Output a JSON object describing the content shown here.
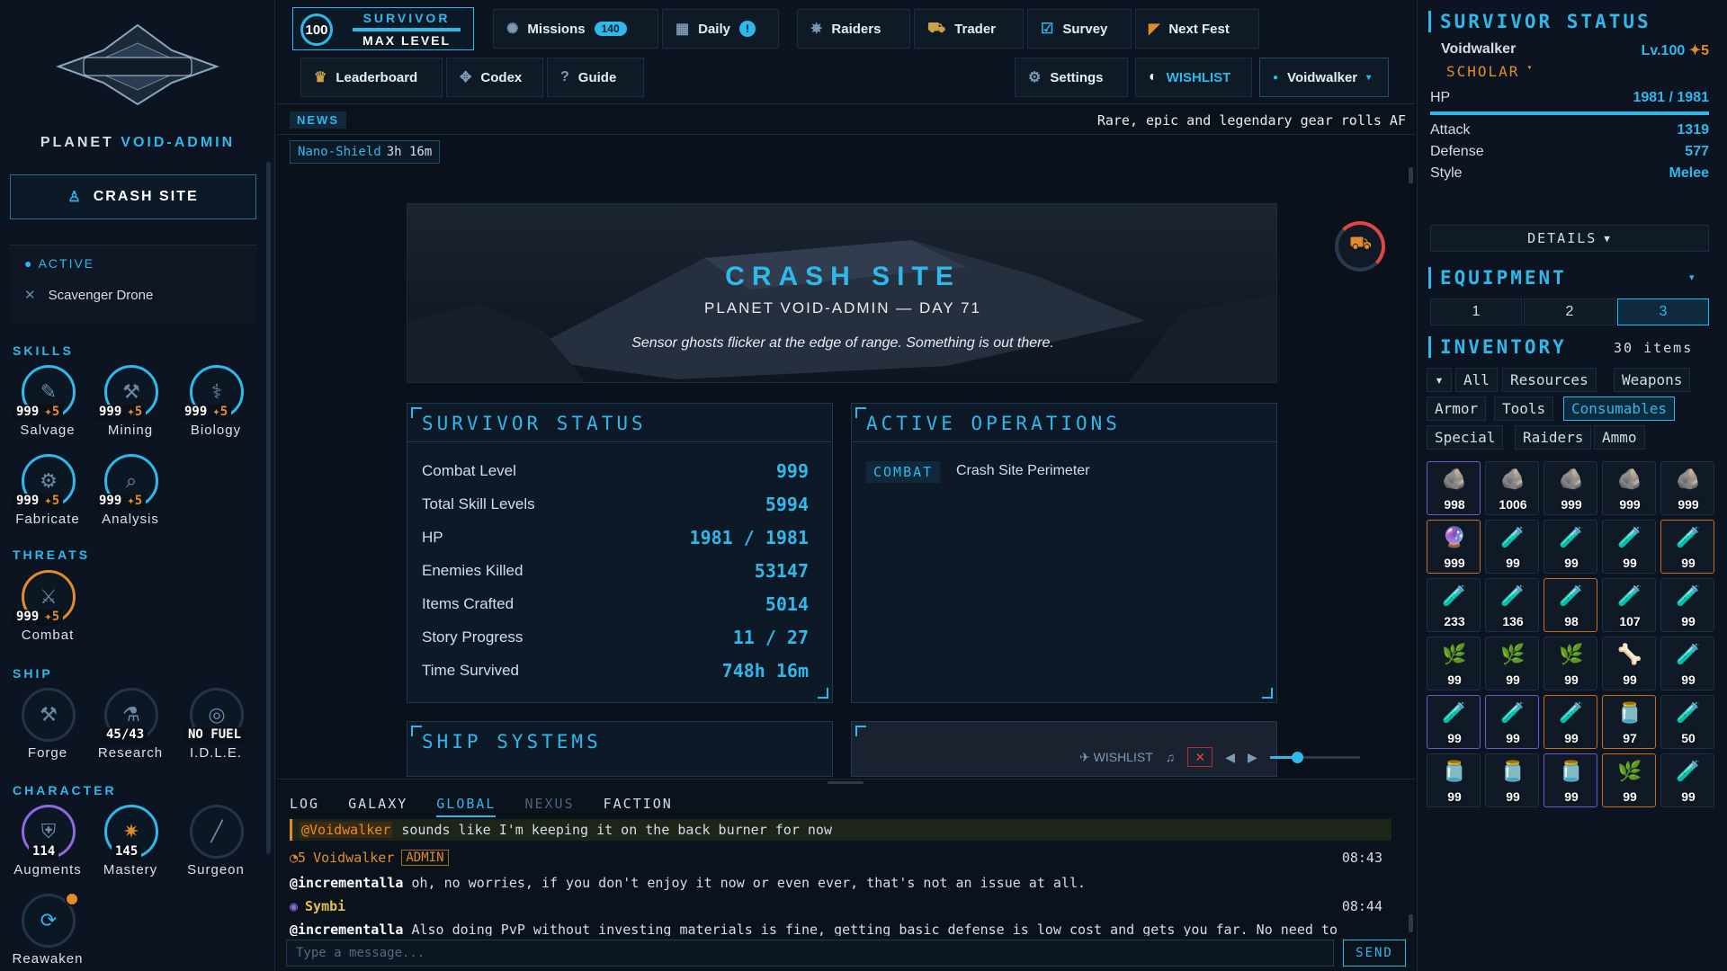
{
  "left": {
    "planet_prefix": "PLANET",
    "planet_name": "VOID-ADMIN",
    "crash_site_label": "CRASH SITE",
    "active_label": "ACTIVE",
    "active_item": "Scavenger Drone",
    "skills_title": "SKILLS",
    "skills": [
      {
        "name": "Salvage",
        "level": "999",
        "bonus": "5",
        "icon": "wrench-icon"
      },
      {
        "name": "Mining",
        "level": "999",
        "bonus": "5",
        "icon": "pickaxe-icon"
      },
      {
        "name": "Biology",
        "level": "999",
        "bonus": "5",
        "icon": "syringe-icon"
      },
      {
        "name": "Fabricate",
        "level": "999",
        "bonus": "5",
        "icon": "anvil-icon"
      },
      {
        "name": "Analysis",
        "level": "999",
        "bonus": "5",
        "icon": "magnifier-icon"
      }
    ],
    "threats_title": "THREATS",
    "threats": [
      {
        "name": "Combat",
        "level": "999",
        "bonus": "5",
        "icon": "crossed-swords-icon"
      }
    ],
    "ship_title": "SHIP",
    "ship": [
      {
        "name": "Forge",
        "value": "",
        "icon": "forge-icon"
      },
      {
        "name": "Research",
        "value": "45/43",
        "icon": "flask-icon"
      },
      {
        "name": "I.D.L.E.",
        "value": "NO FUEL",
        "icon": "ai-core-icon"
      }
    ],
    "character_title": "CHARACTER",
    "character": [
      {
        "name": "Augments",
        "value": "114",
        "icon": "shield-augment-icon"
      },
      {
        "name": "Mastery",
        "value": "145",
        "icon": "mastery-star-icon"
      },
      {
        "name": "Surgeon",
        "value": "",
        "icon": "scalpel-icon"
      },
      {
        "name": "Reawaken",
        "value": "",
        "icon": "reawaken-icon"
      }
    ]
  },
  "top": {
    "level": "100",
    "level_title": "SURVIVOR",
    "level_status": "MAX LEVEL",
    "missions_label": "Missions",
    "missions_count": "140",
    "daily_label": "Daily",
    "daily_badge": "!",
    "raiders_label": "Raiders",
    "trader_label": "Trader",
    "survey_label": "Survey",
    "next_fest_label": "Next Fest",
    "leaderboard_label": "Leaderboard",
    "codex_label": "Codex",
    "guide_label": "Guide",
    "settings_label": "Settings",
    "wishlist_label": "WISHLIST",
    "user_label": "Voidwalker"
  },
  "news": {
    "tag": "NEWS",
    "text": "Rare, epic and legendary gear rolls AF",
    "buff_name": "Nano-Shield",
    "buff_time": "3h 16m"
  },
  "hero": {
    "title": "CRASH SITE",
    "subtitle": "PLANET VOID-ADMIN — DAY 71",
    "description": "Sensor ghosts flicker at the edge of range. Something is out there."
  },
  "survivor_panel": {
    "title": "SURVIVOR STATUS",
    "rows": [
      {
        "label": "Combat Level",
        "value": "999"
      },
      {
        "label": "Total Skill Levels",
        "value": "5994"
      },
      {
        "label": "HP",
        "value": "1981 / 1981"
      },
      {
        "label": "Enemies Killed",
        "value": "53147"
      },
      {
        "label": "Items Crafted",
        "value": "5014"
      },
      {
        "label": "Story Progress",
        "value": "11 / 27"
      },
      {
        "label": "Time Survived",
        "value": "748h 16m"
      }
    ]
  },
  "operations_panel": {
    "title": "ACTIVE OPERATIONS",
    "tag": "COMBAT",
    "operation": "Crash Site Perimeter"
  },
  "ship_systems_title": "SHIP SYSTEMS",
  "music": {
    "wishlist": "WISHLIST",
    "close": "✕",
    "volume": 0.3
  },
  "chat": {
    "tabs": [
      "LOG",
      "GALAXY",
      "GLOBAL",
      "NEXUS",
      "FACTION"
    ],
    "active_tab": "GLOBAL",
    "quote_mention": "@Voidwalker",
    "quote_text": "sounds like I'm keeping it on the back burner for now",
    "msg1_badge": "5",
    "msg1_user": "Voidwalker",
    "msg1_role": "ADMIN",
    "msg1_time": "08:43",
    "msg1_mention": "@incrementalla",
    "msg1_text": "oh, no worries, if you don't enjoy it now or even ever, that's not an issue at all.",
    "msg2_user": "Symbi",
    "msg2_time": "08:44",
    "msg2_mention": "@incrementalla",
    "msg2_text": "Also doing PvP without investing materials is fine, getting basic defense is low cost and gets you far. No need to",
    "input_placeholder": "Type a message...",
    "send_label": "SEND"
  },
  "right": {
    "status_title": "SURVIVOR STATUS",
    "name": "Voidwalker",
    "level": "Lv.100",
    "prestige": "5",
    "class": "SCHOLAR",
    "hp_label": "HP",
    "hp_value": "1981 / 1981",
    "hp_fraction": 1.0,
    "attack_label": "Attack",
    "attack_value": "1319",
    "defense_label": "Defense",
    "defense_value": "577",
    "style_label": "Style",
    "style_value": "Melee",
    "details_label": "DETAILS",
    "equipment_title": "EQUIPMENT",
    "loadouts": [
      "1",
      "2",
      "3"
    ],
    "active_loadout": "3",
    "inventory_title": "INVENTORY",
    "inventory_count": "30 items",
    "filters": [
      "All",
      "Resources",
      "Weapons",
      "Armor",
      "Tools",
      "Consumables",
      "Special",
      "Raiders",
      "Ammo"
    ],
    "active_filter": "Consumables",
    "items": [
      {
        "count": "998",
        "glyph": "🪨",
        "rarity": "purple"
      },
      {
        "count": "1006",
        "glyph": "🪨",
        "rarity": "normal"
      },
      {
        "count": "999",
        "glyph": "🪨",
        "rarity": "normal"
      },
      {
        "count": "999",
        "glyph": "🪨",
        "rarity": "normal"
      },
      {
        "count": "999",
        "glyph": "🪨",
        "rarity": "normal"
      },
      {
        "count": "999",
        "glyph": "🔮",
        "rarity": "orange"
      },
      {
        "count": "99",
        "glyph": "🧪",
        "rarity": "normal"
      },
      {
        "count": "99",
        "glyph": "🧪",
        "rarity": "normal"
      },
      {
        "count": "99",
        "glyph": "🧪",
        "rarity": "normal"
      },
      {
        "count": "99",
        "glyph": "🧪",
        "rarity": "orange"
      },
      {
        "count": "233",
        "glyph": "🧪",
        "rarity": "normal"
      },
      {
        "count": "136",
        "glyph": "🧪",
        "rarity": "normal"
      },
      {
        "count": "98",
        "glyph": "🧪",
        "rarity": "orange"
      },
      {
        "count": "107",
        "glyph": "🧪",
        "rarity": "normal"
      },
      {
        "count": "99",
        "glyph": "🧪",
        "rarity": "normal"
      },
      {
        "count": "99",
        "glyph": "🌿",
        "rarity": "normal"
      },
      {
        "count": "99",
        "glyph": "🌿",
        "rarity": "normal"
      },
      {
        "count": "99",
        "glyph": "🌿",
        "rarity": "normal"
      },
      {
        "count": "99",
        "glyph": "🦴",
        "rarity": "normal"
      },
      {
        "count": "99",
        "glyph": "🧪",
        "rarity": "normal"
      },
      {
        "count": "99",
        "glyph": "🧪",
        "rarity": "purple"
      },
      {
        "count": "99",
        "glyph": "🧪",
        "rarity": "purple"
      },
      {
        "count": "99",
        "glyph": "🧪",
        "rarity": "orange"
      },
      {
        "count": "97",
        "glyph": "🫙",
        "rarity": "orange"
      },
      {
        "count": "50",
        "glyph": "🧪",
        "rarity": "normal"
      },
      {
        "count": "99",
        "glyph": "🫙",
        "rarity": "normal"
      },
      {
        "count": "99",
        "glyph": "🫙",
        "rarity": "normal"
      },
      {
        "count": "99",
        "glyph": "🫙",
        "rarity": "purple"
      },
      {
        "count": "99",
        "glyph": "🌿",
        "rarity": "orange"
      },
      {
        "count": "99",
        "glyph": "🧪",
        "rarity": "normal"
      }
    ]
  }
}
